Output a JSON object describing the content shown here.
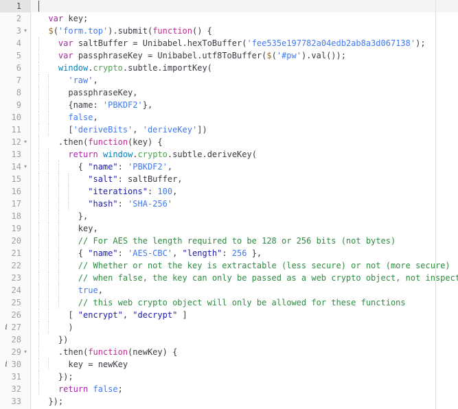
{
  "editor": {
    "language": "javascript",
    "total_lines": 33,
    "active_line": 1,
    "cursor": {
      "line": 1,
      "column": 1
    },
    "theme": {
      "background": "#ffffff",
      "gutter_background": "#fafafa",
      "active_line_background": "#f4f4f4",
      "active_gutter_background": "#e4e4e4",
      "line_number_color": "#9d9d9f",
      "text_color": "#383a42",
      "keyword_color": "#a626a4",
      "function_color": "#c2298f",
      "string_color": "#4078f2",
      "double_quote_string_color": "#1a1aa6",
      "number_color": "#4078f2",
      "comment_color": "#2e8b40",
      "object_color": "#0184bc",
      "property_color": "#50a14f",
      "ruler_color": "#e1e1e1",
      "indent_guide_color": "#d3d3d3"
    },
    "print_guide_column": 80,
    "fold_arrow_glyph": "▾",
    "info_marker_glyph": "i",
    "fold_lines": [
      3,
      12,
      14,
      29
    ],
    "info_lines": [
      27,
      30
    ]
  },
  "lines": [
    {
      "number": 1,
      "indent_guides": 0,
      "tokens": []
    },
    {
      "number": 2,
      "indent_guides": 0,
      "tokens": [
        {
          "t": "  ",
          "c": "tok-plain"
        },
        {
          "t": "var",
          "c": "tok-kw"
        },
        {
          "t": " key;",
          "c": "tok-plain"
        }
      ]
    },
    {
      "number": 3,
      "indent_guides": 0,
      "tokens": [
        {
          "t": "  ",
          "c": "tok-plain"
        },
        {
          "t": "$",
          "c": "tok-dollar"
        },
        {
          "t": "(",
          "c": "tok-punct"
        },
        {
          "t": "'form.top'",
          "c": "tok-str"
        },
        {
          "t": ").submit(",
          "c": "tok-punct"
        },
        {
          "t": "function",
          "c": "tok-fn"
        },
        {
          "t": "() {",
          "c": "tok-punct"
        }
      ]
    },
    {
      "number": 4,
      "indent_guides": 1,
      "tokens": [
        {
          "t": "    ",
          "c": "tok-plain"
        },
        {
          "t": "var",
          "c": "tok-kw"
        },
        {
          "t": " saltBuffer = Unibabel.hexToBuffer(",
          "c": "tok-plain"
        },
        {
          "t": "'fee535e197782a04edb2ab8a3d067138'",
          "c": "tok-str"
        },
        {
          "t": ");",
          "c": "tok-plain"
        }
      ]
    },
    {
      "number": 5,
      "indent_guides": 1,
      "tokens": [
        {
          "t": "    ",
          "c": "tok-plain"
        },
        {
          "t": "var",
          "c": "tok-kw"
        },
        {
          "t": " passphraseKey = Unibabel.utf8ToBuffer(",
          "c": "tok-plain"
        },
        {
          "t": "$",
          "c": "tok-dollar"
        },
        {
          "t": "(",
          "c": "tok-punct"
        },
        {
          "t": "'#pw'",
          "c": "tok-str"
        },
        {
          "t": ").val());",
          "c": "tok-plain"
        }
      ]
    },
    {
      "number": 6,
      "indent_guides": 1,
      "tokens": [
        {
          "t": "    ",
          "c": "tok-plain"
        },
        {
          "t": "window",
          "c": "tok-obj"
        },
        {
          "t": ".",
          "c": "tok-punct"
        },
        {
          "t": "crypto",
          "c": "tok-prop"
        },
        {
          "t": ".subtle.importKey(",
          "c": "tok-plain"
        }
      ]
    },
    {
      "number": 7,
      "indent_guides": 2,
      "tokens": [
        {
          "t": "      ",
          "c": "tok-plain"
        },
        {
          "t": "'raw'",
          "c": "tok-str"
        },
        {
          "t": ",",
          "c": "tok-plain"
        }
      ]
    },
    {
      "number": 8,
      "indent_guides": 2,
      "tokens": [
        {
          "t": "      passphraseKey,",
          "c": "tok-plain"
        }
      ]
    },
    {
      "number": 9,
      "indent_guides": 2,
      "tokens": [
        {
          "t": "      {name: ",
          "c": "tok-plain"
        },
        {
          "t": "'PBKDF2'",
          "c": "tok-str"
        },
        {
          "t": "},",
          "c": "tok-plain"
        }
      ]
    },
    {
      "number": 10,
      "indent_guides": 2,
      "tokens": [
        {
          "t": "      ",
          "c": "tok-plain"
        },
        {
          "t": "false",
          "c": "tok-const"
        },
        {
          "t": ",",
          "c": "tok-plain"
        }
      ]
    },
    {
      "number": 11,
      "indent_guides": 2,
      "tokens": [
        {
          "t": "      [",
          "c": "tok-plain"
        },
        {
          "t": "'deriveBits'",
          "c": "tok-str"
        },
        {
          "t": ", ",
          "c": "tok-plain"
        },
        {
          "t": "'deriveKey'",
          "c": "tok-str"
        },
        {
          "t": "])",
          "c": "tok-plain"
        }
      ]
    },
    {
      "number": 12,
      "indent_guides": 1,
      "tokens": [
        {
          "t": "    .then(",
          "c": "tok-plain"
        },
        {
          "t": "function",
          "c": "tok-fn"
        },
        {
          "t": "(key) {",
          "c": "tok-plain"
        }
      ]
    },
    {
      "number": 13,
      "indent_guides": 2,
      "tokens": [
        {
          "t": "      ",
          "c": "tok-plain"
        },
        {
          "t": "return",
          "c": "tok-kw"
        },
        {
          "t": " ",
          "c": "tok-plain"
        },
        {
          "t": "window",
          "c": "tok-obj"
        },
        {
          "t": ".",
          "c": "tok-punct"
        },
        {
          "t": "crypto",
          "c": "tok-prop"
        },
        {
          "t": ".subtle.deriveKey(",
          "c": "tok-plain"
        }
      ]
    },
    {
      "number": 14,
      "indent_guides": 3,
      "tokens": [
        {
          "t": "        { ",
          "c": "tok-plain"
        },
        {
          "t": "\"name\"",
          "c": "tok-str2"
        },
        {
          "t": ": ",
          "c": "tok-plain"
        },
        {
          "t": "'PBKDF2'",
          "c": "tok-str"
        },
        {
          "t": ",",
          "c": "tok-plain"
        }
      ]
    },
    {
      "number": 15,
      "indent_guides": 4,
      "tokens": [
        {
          "t": "          ",
          "c": "tok-plain"
        },
        {
          "t": "\"salt\"",
          "c": "tok-str2"
        },
        {
          "t": ": saltBuffer,",
          "c": "tok-plain"
        }
      ]
    },
    {
      "number": 16,
      "indent_guides": 4,
      "tokens": [
        {
          "t": "          ",
          "c": "tok-plain"
        },
        {
          "t": "\"iterations\"",
          "c": "tok-str2"
        },
        {
          "t": ": ",
          "c": "tok-plain"
        },
        {
          "t": "100",
          "c": "tok-num"
        },
        {
          "t": ",",
          "c": "tok-plain"
        }
      ]
    },
    {
      "number": 17,
      "indent_guides": 4,
      "tokens": [
        {
          "t": "          ",
          "c": "tok-plain"
        },
        {
          "t": "\"hash\"",
          "c": "tok-str2"
        },
        {
          "t": ": ",
          "c": "tok-plain"
        },
        {
          "t": "'SHA-256'",
          "c": "tok-str"
        }
      ]
    },
    {
      "number": 18,
      "indent_guides": 3,
      "tokens": [
        {
          "t": "        },",
          "c": "tok-plain"
        }
      ]
    },
    {
      "number": 19,
      "indent_guides": 3,
      "tokens": [
        {
          "t": "        key,",
          "c": "tok-plain"
        }
      ]
    },
    {
      "number": 20,
      "indent_guides": 3,
      "tokens": [
        {
          "t": "        ",
          "c": "tok-plain"
        },
        {
          "t": "// For AES the length required to be 128 or 256 bits (not bytes)",
          "c": "tok-comment"
        }
      ]
    },
    {
      "number": 21,
      "indent_guides": 3,
      "tokens": [
        {
          "t": "        { ",
          "c": "tok-plain"
        },
        {
          "t": "\"name\"",
          "c": "tok-str2"
        },
        {
          "t": ": ",
          "c": "tok-plain"
        },
        {
          "t": "'AES-CBC'",
          "c": "tok-str"
        },
        {
          "t": ", ",
          "c": "tok-plain"
        },
        {
          "t": "\"length\"",
          "c": "tok-str2"
        },
        {
          "t": ": ",
          "c": "tok-plain"
        },
        {
          "t": "256",
          "c": "tok-num"
        },
        {
          "t": " },",
          "c": "tok-plain"
        }
      ]
    },
    {
      "number": 22,
      "indent_guides": 3,
      "tokens": [
        {
          "t": "        ",
          "c": "tok-plain"
        },
        {
          "t": "// Whether or not the key is extractable (less secure) or not (more secure)",
          "c": "tok-comment"
        }
      ]
    },
    {
      "number": 23,
      "indent_guides": 3,
      "tokens": [
        {
          "t": "        ",
          "c": "tok-plain"
        },
        {
          "t": "// when false, the key can only be passed as a web crypto object, not inspected",
          "c": "tok-comment"
        }
      ]
    },
    {
      "number": 24,
      "indent_guides": 3,
      "tokens": [
        {
          "t": "        ",
          "c": "tok-plain"
        },
        {
          "t": "true",
          "c": "tok-const"
        },
        {
          "t": ",",
          "c": "tok-plain"
        }
      ]
    },
    {
      "number": 25,
      "indent_guides": 3,
      "tokens": [
        {
          "t": "        ",
          "c": "tok-plain"
        },
        {
          "t": "// this web crypto object will only be allowed for these functions",
          "c": "tok-comment"
        }
      ]
    },
    {
      "number": 26,
      "indent_guides": 2,
      "tokens": [
        {
          "t": "      [ ",
          "c": "tok-plain"
        },
        {
          "t": "\"encrypt\"",
          "c": "tok-str2"
        },
        {
          "t": ", ",
          "c": "tok-plain"
        },
        {
          "t": "\"decrypt\"",
          "c": "tok-str2"
        },
        {
          "t": " ]",
          "c": "tok-plain"
        }
      ]
    },
    {
      "number": 27,
      "indent_guides": 2,
      "tokens": [
        {
          "t": "      )",
          "c": "tok-plain"
        }
      ]
    },
    {
      "number": 28,
      "indent_guides": 1,
      "tokens": [
        {
          "t": "    })",
          "c": "tok-plain"
        }
      ]
    },
    {
      "number": 29,
      "indent_guides": 1,
      "tokens": [
        {
          "t": "    .then(",
          "c": "tok-plain"
        },
        {
          "t": "function",
          "c": "tok-fn"
        },
        {
          "t": "(newKey) {",
          "c": "tok-plain"
        }
      ]
    },
    {
      "number": 30,
      "indent_guides": 2,
      "tokens": [
        {
          "t": "      key = newKey",
          "c": "tok-plain"
        }
      ]
    },
    {
      "number": 31,
      "indent_guides": 1,
      "tokens": [
        {
          "t": "    });",
          "c": "tok-plain"
        }
      ]
    },
    {
      "number": 32,
      "indent_guides": 1,
      "tokens": [
        {
          "t": "    ",
          "c": "tok-plain"
        },
        {
          "t": "return",
          "c": "tok-kw"
        },
        {
          "t": " ",
          "c": "tok-plain"
        },
        {
          "t": "false",
          "c": "tok-const"
        },
        {
          "t": ";",
          "c": "tok-plain"
        }
      ]
    },
    {
      "number": 33,
      "indent_guides": 0,
      "tokens": [
        {
          "t": "  });",
          "c": "tok-plain"
        }
      ]
    }
  ]
}
